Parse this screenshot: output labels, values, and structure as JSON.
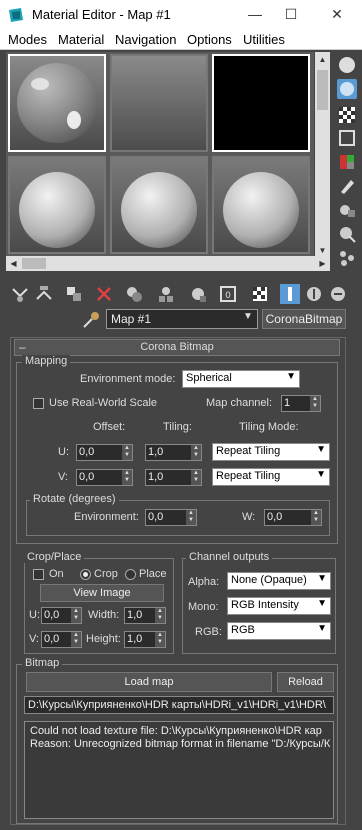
{
  "window": {
    "title": "Material Editor - Map #1",
    "minimize": "—",
    "maximize": "☐",
    "close": "✕"
  },
  "menu": [
    "Modes",
    "Material",
    "Navigation",
    "Options",
    "Utilities"
  ],
  "map_name": "Map #1",
  "map_type": "CoronaBitmap",
  "rollout_title": "Corona Bitmap",
  "rollout_toggle": "–",
  "mapping": {
    "title": "Mapping",
    "env_mode_label": "Environment mode:",
    "env_mode_value": "Spherical",
    "real_world_label": "Use Real-World Scale",
    "map_channel_label": "Map channel:",
    "map_channel_value": "1",
    "offset_label": "Offset:",
    "tiling_label": "Tiling:",
    "tiling_mode_label": "Tiling Mode:",
    "u_label": "U:",
    "v_label": "V:",
    "u_offset": "0,0",
    "u_tiling": "1,0",
    "u_mode": "Repeat Tiling",
    "v_offset": "0,0",
    "v_tiling": "1,0",
    "v_mode": "Repeat Tiling"
  },
  "rotate": {
    "title": "Rotate (degrees)",
    "env_label": "Environment:",
    "env_value": "0,0",
    "w_label": "W:",
    "w_value": "0,0"
  },
  "crop": {
    "title": "Crop/Place",
    "on_label": "On",
    "crop_label": "Crop",
    "place_label": "Place",
    "view_image": "View Image",
    "u_label": "U:",
    "u_value": "0,0",
    "width_label": "Width:",
    "width_value": "1,0",
    "v_label": "V:",
    "v_value": "0,0",
    "height_label": "Height:",
    "height_value": "1,0"
  },
  "channels": {
    "title": "Channel outputs",
    "alpha_label": "Alpha:",
    "alpha_value": "None (Opaque)",
    "mono_label": "Mono:",
    "mono_value": "RGB Intensity",
    "rgb_label": "RGB:",
    "rgb_value": "RGB"
  },
  "bitmap": {
    "title": "Bitmap",
    "load_map": "Load map",
    "reload": "Reload",
    "path": "D:\\Курсы\\Куприяненко\\HDR карты\\HDRi_v1\\HDRi_v1\\HDR\\",
    "message_line1": "Could not load texture file: D:\\Курсы\\Куприяненко\\HDR кар",
    "message_line2": "Reason: Unrecognized bitmap format in filename \"D:/Курсы/К"
  },
  "colors": {
    "panel_bg": "#444444",
    "accent_blue": "#5b9bd5"
  }
}
